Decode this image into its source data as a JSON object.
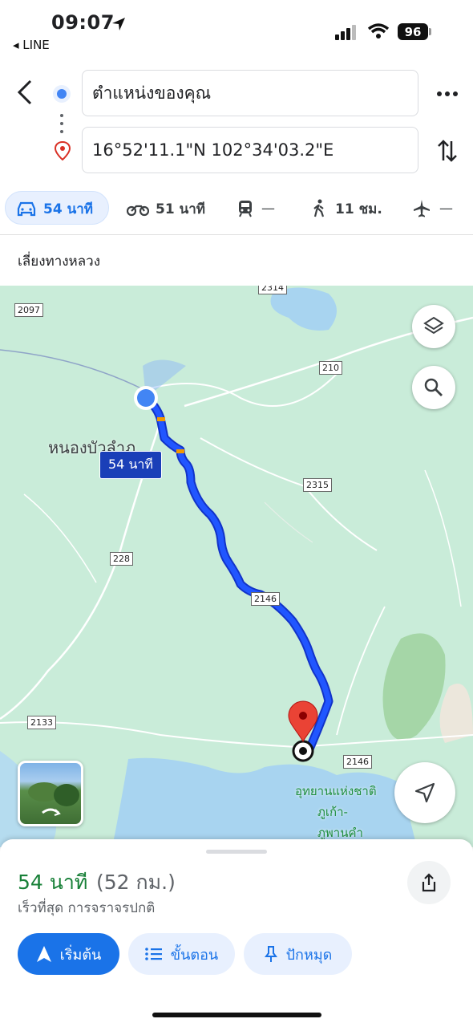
{
  "status": {
    "time": "09:07",
    "back_app": "◂ LINE",
    "battery": "96"
  },
  "route_inputs": {
    "origin": "ตำแหน่งของคุณ",
    "destination": "16°52'11.1\"N 102°34'03.2\"E"
  },
  "modes": [
    {
      "id": "drive",
      "label": "54 นาที",
      "icon": "car-icon"
    },
    {
      "id": "motorcycle",
      "label": "51 นาที",
      "icon": "motorcycle-icon"
    },
    {
      "id": "transit",
      "label": "—",
      "icon": "train-icon"
    },
    {
      "id": "walk",
      "label": "11 ชม.",
      "icon": "walk-icon"
    },
    {
      "id": "flight",
      "label": "—",
      "icon": "plane-icon"
    }
  ],
  "options": {
    "avoid_highways": "เลี่ยงทางหลวง"
  },
  "map": {
    "town_label": "หนองบัวลำภู",
    "route_time_label": "54 นาที",
    "park_label_1": "อุทยานแห่งชาติ",
    "park_label_2": "ภูเก้า-",
    "park_label_3": "ภูพานคำ",
    "road_numbers": [
      "2314",
      "2097",
      "210",
      "2315",
      "228",
      "2146",
      "2133",
      "2146"
    ]
  },
  "summary": {
    "duration": "54 นาที",
    "distance": "(52 กม.)",
    "note": "เร็วที่สุด การจราจรปกติ"
  },
  "actions": {
    "start": "เริ่มต้น",
    "steps": "ขั้นตอน",
    "pin": "ปักหมุด"
  },
  "colors": {
    "accent": "#1a73e8",
    "route": "#1f4cf0",
    "green_text": "#188038",
    "map_green": "#c9ecd9",
    "water": "#a8d4f0"
  }
}
